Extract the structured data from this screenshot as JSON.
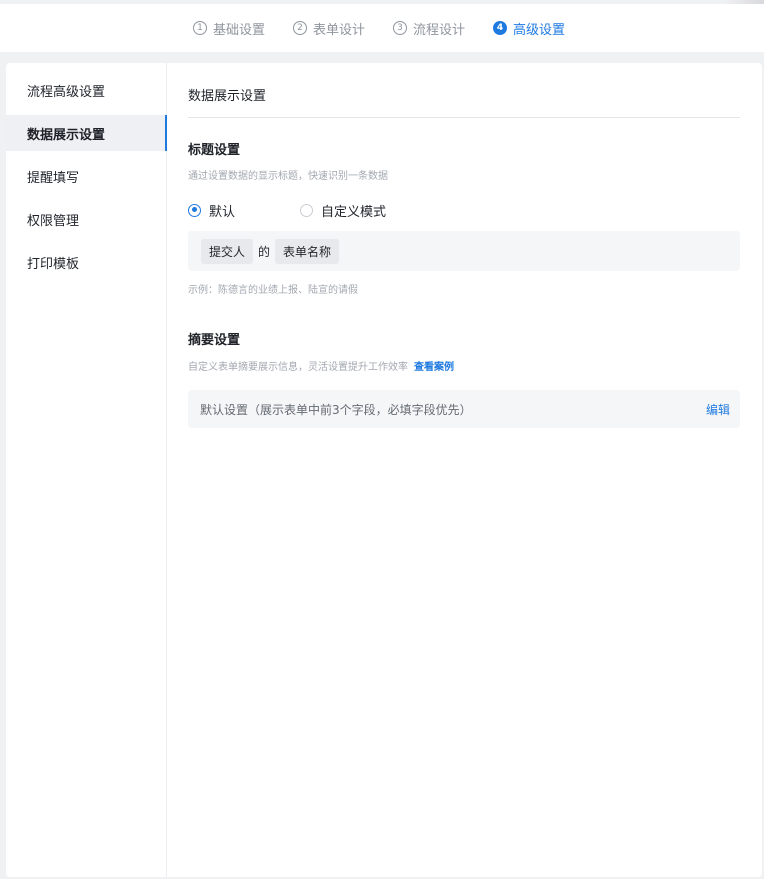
{
  "steps": [
    {
      "num": "1",
      "label": "基础设置",
      "active": false
    },
    {
      "num": "2",
      "label": "表单设计",
      "active": false
    },
    {
      "num": "3",
      "label": "流程设计",
      "active": false
    },
    {
      "num": "4",
      "label": "高级设置",
      "active": true
    }
  ],
  "sidebar": {
    "items": [
      {
        "label": "流程高级设置"
      },
      {
        "label": "数据展示设置"
      },
      {
        "label": "提醒填写"
      },
      {
        "label": "权限管理"
      },
      {
        "label": "打印模板"
      }
    ],
    "active_index": 1
  },
  "panel": {
    "title": "数据展示设置"
  },
  "title_settings": {
    "heading": "标题设置",
    "description": "通过设置数据的显示标题，快速识别一条数据",
    "option_default": "默认",
    "option_custom": "自定义模式",
    "selected": "默认",
    "chip_submitter": "提交人",
    "connector": "的",
    "chip_form_name": "表单名称",
    "example": "示例：陈德言的业绩上报、陆宣的请假"
  },
  "summary_settings": {
    "heading": "摘要设置",
    "description": "自定义表单摘要展示信息，灵活设置提升工作效率",
    "link": "查看案例",
    "box_text": "默认设置（展示表单中前3个字段，必填字段优先）",
    "edit": "编辑"
  },
  "colors": {
    "accent": "#1f7ae0",
    "background": "#f0f1f3",
    "muted_text": "#a3a8b0"
  }
}
